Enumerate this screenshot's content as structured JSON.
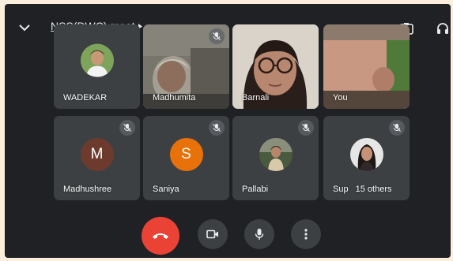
{
  "meeting": {
    "title": "NSS(DWC) meet"
  },
  "participants_top": [
    {
      "name": "WADEKAR"
    },
    {
      "name": "Madhumita"
    },
    {
      "name": "Barnali"
    },
    {
      "name": "You"
    }
  ],
  "participants_bottom": [
    {
      "name": "Madhushree",
      "initial": "M",
      "color": "#6d3b2e"
    },
    {
      "name": "Saniya",
      "initial": "S",
      "color": "#e8710a"
    },
    {
      "name": "Pallabi"
    },
    {
      "name": "Sup",
      "others": "15 others"
    }
  ],
  "colors": {
    "end_call": "#ea4335",
    "control_bg": "#3c4043",
    "tile_bg": "#3c4043",
    "frame_bg": "#202124"
  },
  "icons": {
    "collapse": "chevron-down-icon",
    "camera_switch": "switch-camera-icon",
    "audio": "headphones-icon",
    "muted": "mic-off-icon",
    "end_call": "phone-hangup-icon",
    "camera": "video-camera-icon",
    "mic": "microphone-icon",
    "more": "more-vertical-icon"
  }
}
